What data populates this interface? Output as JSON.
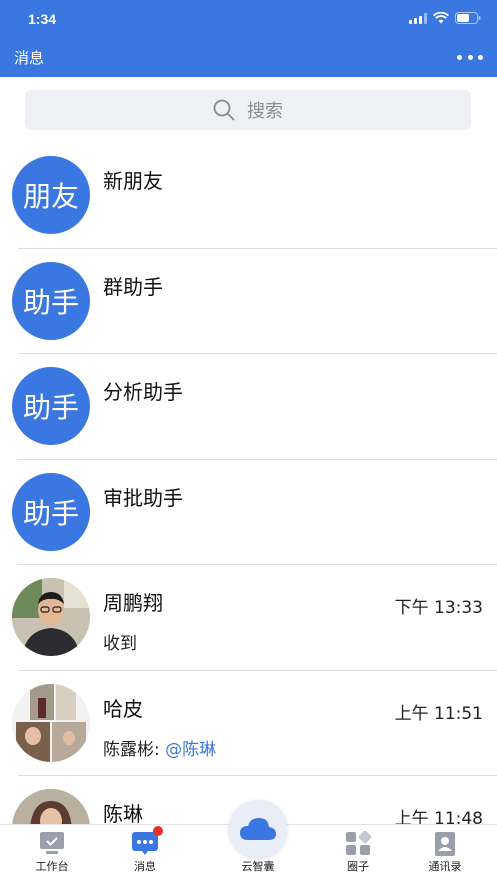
{
  "status_bar": {
    "time": "1:34"
  },
  "header": {
    "title": "消息"
  },
  "search": {
    "placeholder": "搜索"
  },
  "conversations": [
    {
      "avatar_text": "朋友",
      "name": "新朋友",
      "time": "",
      "preview": ""
    },
    {
      "avatar_text": "助手",
      "name": "群助手",
      "time": "",
      "preview": ""
    },
    {
      "avatar_text": "助手",
      "name": "分析助手",
      "time": "",
      "preview": ""
    },
    {
      "avatar_text": "助手",
      "name": "审批助手",
      "time": "",
      "preview": ""
    },
    {
      "avatar_text": "",
      "name": "周鹏翔",
      "time": "下午 13:33",
      "preview": "收到"
    },
    {
      "avatar_text": "",
      "name": "哈皮",
      "time": "上午 11:51",
      "preview_prefix": "陈露彬: ",
      "preview_mention": "@陈琳"
    },
    {
      "avatar_text": "",
      "name": "陈琳",
      "time": "上午 11:48",
      "preview": ""
    }
  ],
  "tabbar": {
    "tabs": [
      {
        "label": "工作台",
        "icon": "workbench-icon"
      },
      {
        "label": "消息",
        "icon": "message-icon"
      },
      {
        "label": "云智囊",
        "icon": "cloud-icon"
      },
      {
        "label": "圈子",
        "icon": "circle-icon"
      },
      {
        "label": "通讯录",
        "icon": "contacts-icon"
      }
    ]
  },
  "colors": {
    "accent": "#3b77e0",
    "badge": "#e8302b"
  }
}
